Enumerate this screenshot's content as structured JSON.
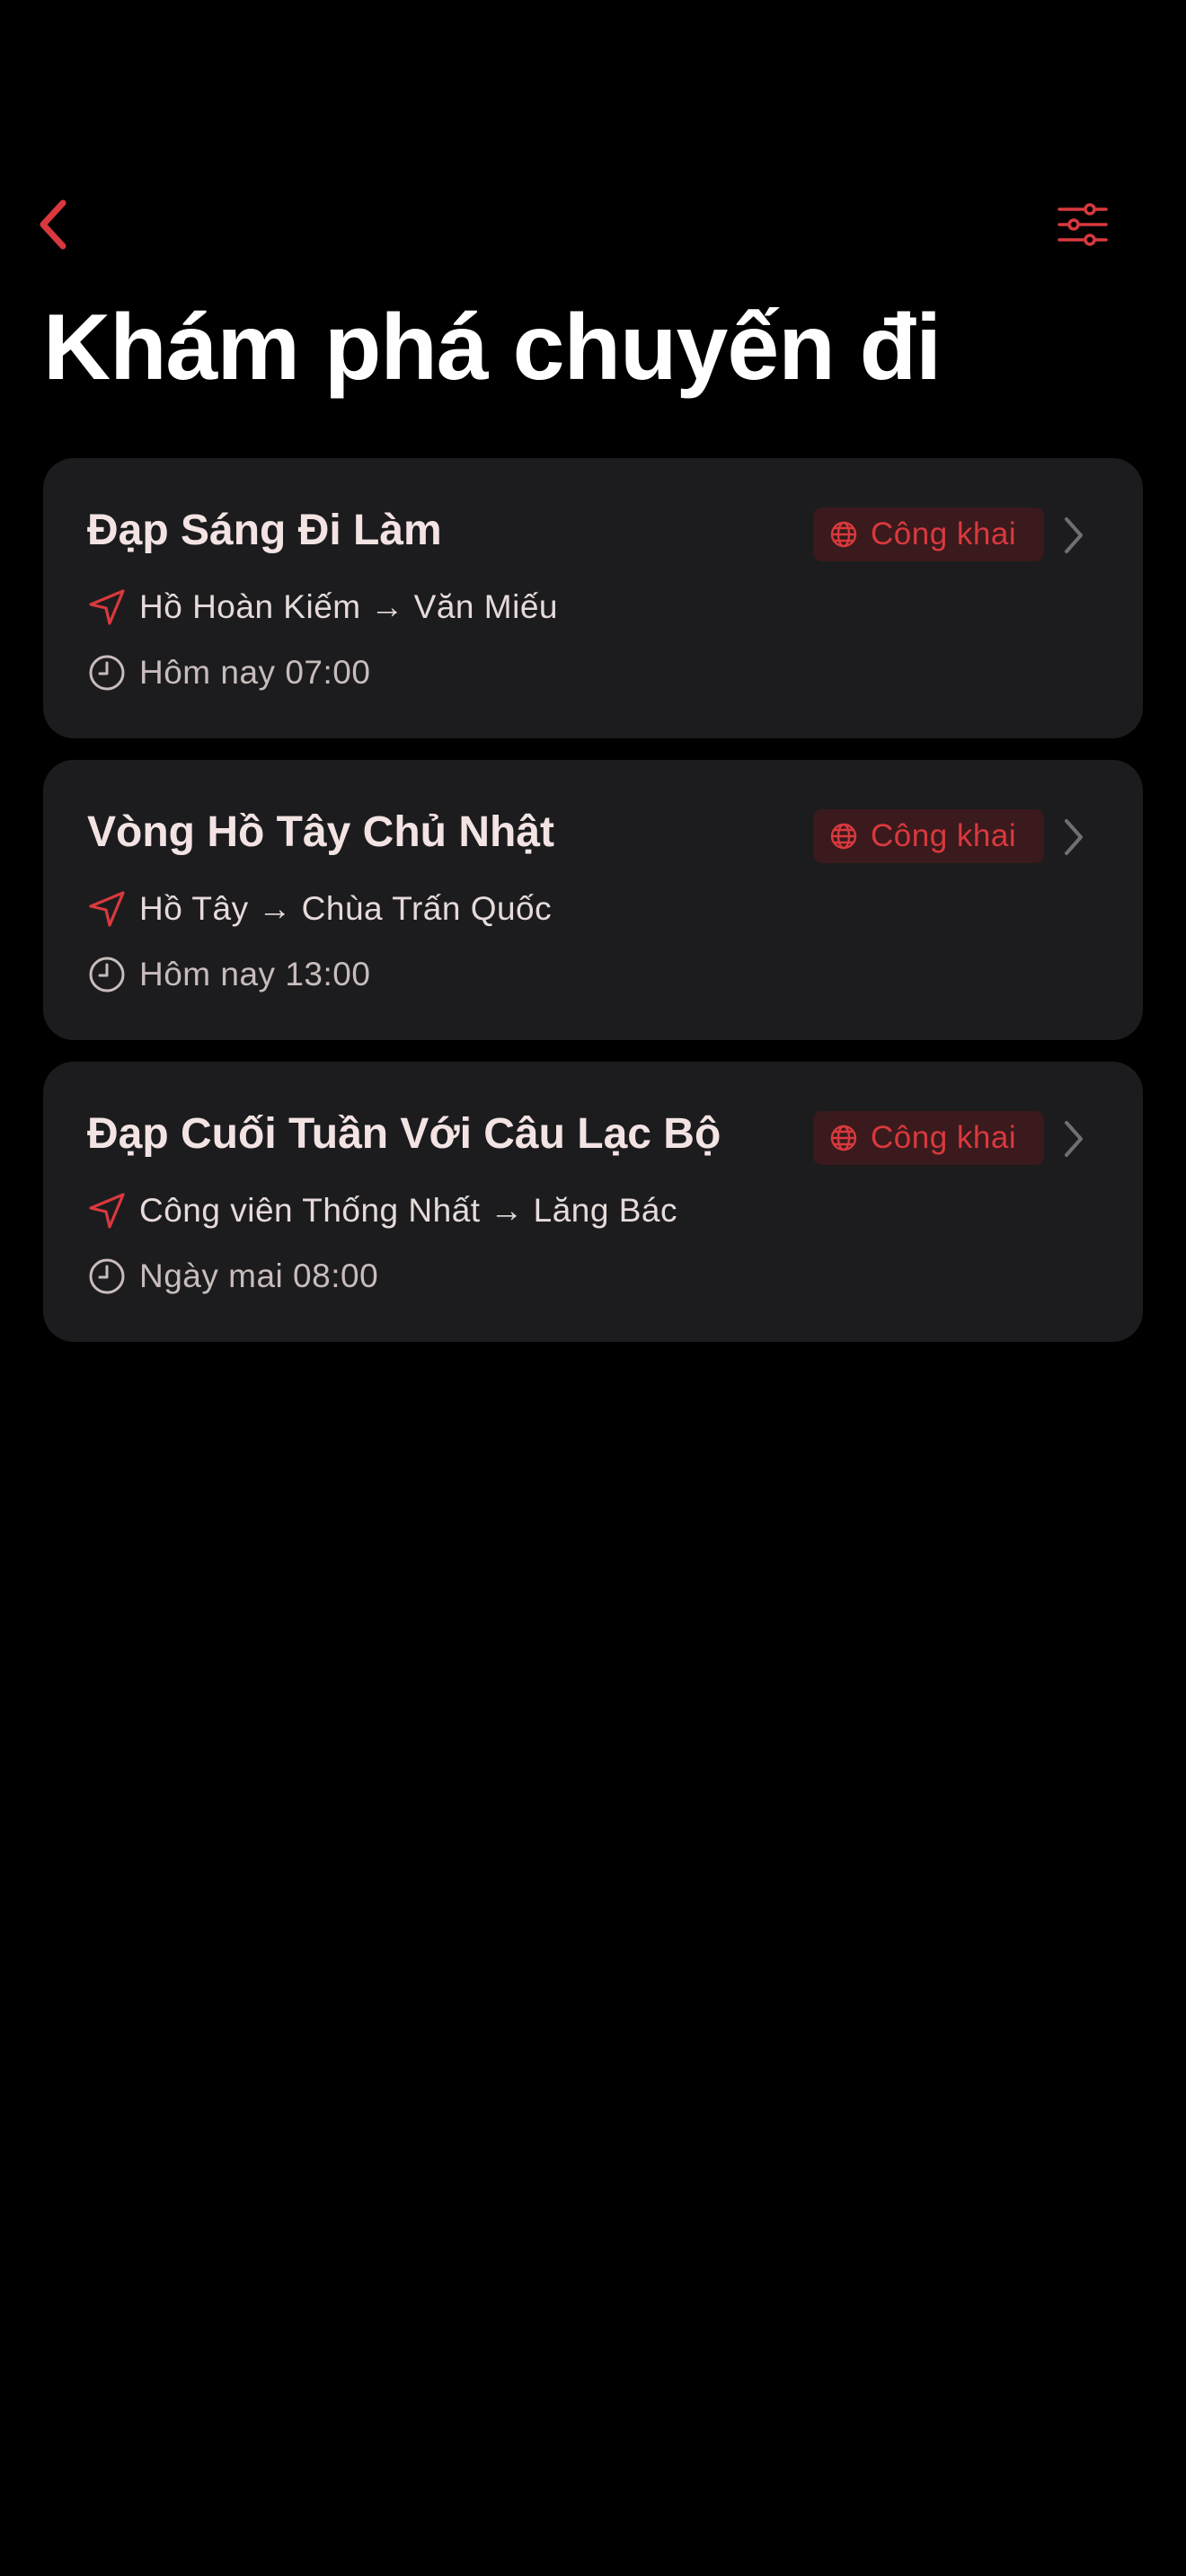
{
  "colors": {
    "background": "#000000",
    "card": "#1c1c1e",
    "accent": "#d9393e",
    "badge_bg": "#3a1a1c",
    "title_text": "#f3e3e3"
  },
  "nav": {
    "back_icon": "chevron-left-icon",
    "filter_icon": "sliders-icon"
  },
  "page_title": "Khám phá chuyến đi",
  "trips": [
    {
      "title": "Đạp Sáng Đi Làm",
      "badge": "Công khai",
      "route": "Hồ Hoàn Kiếm → Văn Miếu",
      "time": "Hôm nay 07:00"
    },
    {
      "title": "Vòng Hồ Tây Chủ Nhật",
      "badge": "Công khai",
      "route": "Hồ Tây → Chùa Trấn Quốc",
      "time": "Hôm nay 13:00"
    },
    {
      "title": "Đạp Cuối Tuần Với Câu Lạc Bộ",
      "badge": "Công khai",
      "route": "Công viên Thống Nhất → Lăng Bác",
      "time": "Ngày mai 08:00"
    }
  ]
}
